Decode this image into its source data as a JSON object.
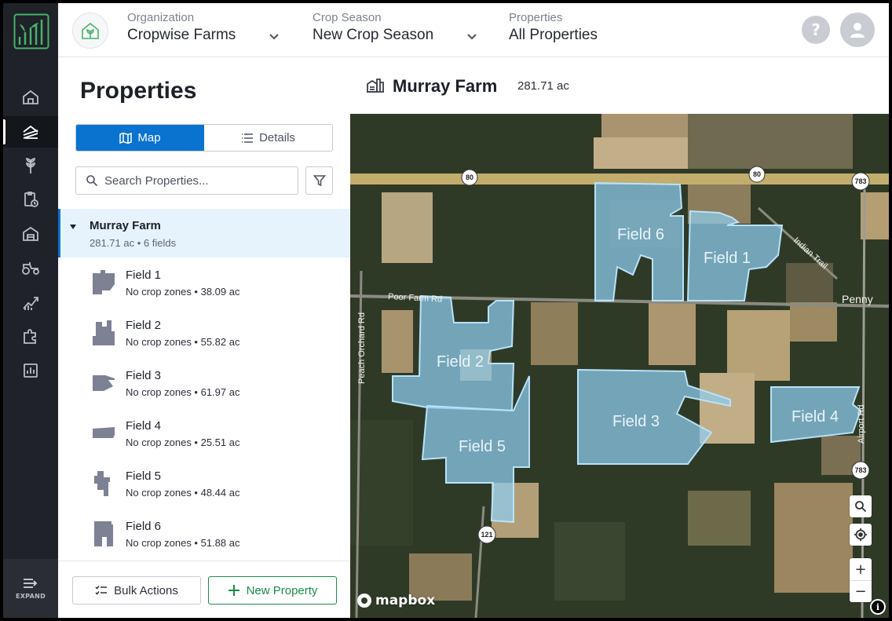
{
  "header": {
    "organization": {
      "caption": "Organization",
      "value": "Cropwise Farms"
    },
    "crop_season": {
      "caption": "Crop Season",
      "value": "New Crop Season"
    },
    "properties": {
      "caption": "Properties",
      "value": "All Properties"
    },
    "help_glyph": "?"
  },
  "rail": {
    "items": [
      "home-icon",
      "properties-icon",
      "crop-icon",
      "tasks-icon",
      "warehouse-icon",
      "equipment-icon",
      "analytics-icon",
      "integrations-icon",
      "reports-icon"
    ],
    "active": "properties-icon",
    "expand_label": "EXPAND"
  },
  "panel": {
    "title": "Properties",
    "view_toggle": {
      "map": "Map",
      "details": "Details",
      "active": "map"
    },
    "search": {
      "placeholder": "Search Properties..."
    },
    "farm": {
      "name": "Murray Farm",
      "meta": "281.71 ac • 6 fields"
    },
    "fields": [
      {
        "name": "Field 1",
        "meta": "No crop zones • 38.09 ac"
      },
      {
        "name": "Field 2",
        "meta": "No crop zones • 55.82 ac"
      },
      {
        "name": "Field 3",
        "meta": "No crop zones • 61.97 ac"
      },
      {
        "name": "Field 4",
        "meta": "No crop zones • 25.51 ac"
      },
      {
        "name": "Field 5",
        "meta": "No crop zones • 48.44 ac"
      },
      {
        "name": "Field 6",
        "meta": "No crop zones • 51.88 ac"
      }
    ],
    "footer": {
      "bulk_actions": "Bulk Actions",
      "new_property": "New Property"
    }
  },
  "map": {
    "title": "Murray Farm",
    "area": "281.71 ac",
    "field_labels": [
      "Field 1",
      "Field 2",
      "Field 3",
      "Field 4",
      "Field 5",
      "Field 6"
    ],
    "road_labels": {
      "poor_farm": "Poor Farm Rd",
      "peach_orchard": "Peach Orchard Rd",
      "indian_trail": "Indian Trail",
      "airport": "Airport Rd",
      "penny": "Penny"
    },
    "shields": {
      "hwy80": "80",
      "hwy783": "783",
      "hwy121": "121"
    },
    "attribution": "mapbox",
    "zoom_in": "+",
    "zoom_out": "−",
    "info_glyph": "i"
  },
  "colors": {
    "accent": "#0a72cf",
    "rail_bg": "#1f2229",
    "new_property": "#1c8a4a",
    "field_fill": "#8fcdf0",
    "field_thumb": "#7c8294"
  }
}
